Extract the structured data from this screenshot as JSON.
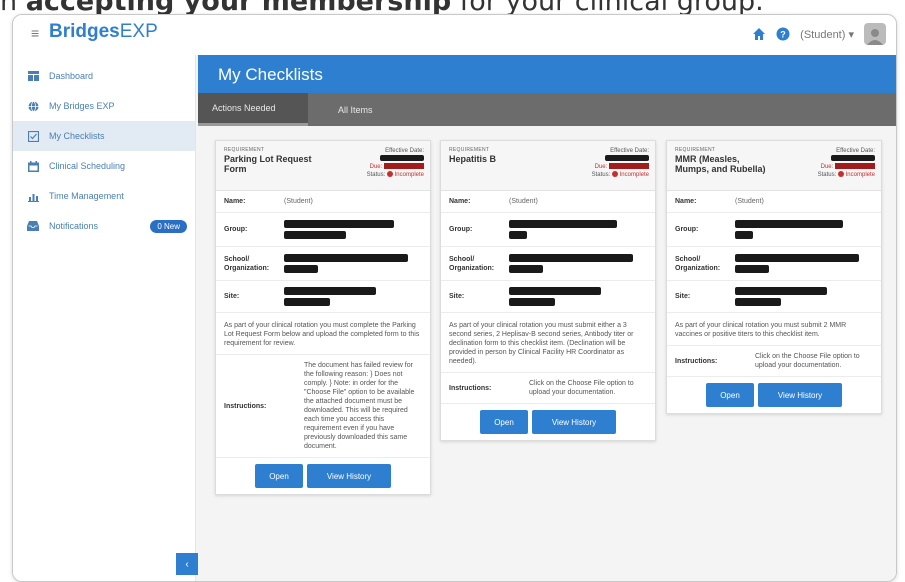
{
  "caption": {
    "prefix": "n ",
    "bold": "accepting your membership",
    "suffix": " for your clinical group."
  },
  "app": {
    "logo": "Bridges",
    "logo_suffix": "EXP",
    "user": "(Student)",
    "user_caret": "▾",
    "menu_icon": "hamburger-icon"
  },
  "sidebar": {
    "items": [
      {
        "label": "Dashboard",
        "icon": "dashboard-icon"
      },
      {
        "label": "My Bridges EXP",
        "icon": "globe-icon"
      },
      {
        "label": "My Checklists",
        "icon": "checklist-icon",
        "active": true
      },
      {
        "label": "Clinical Scheduling",
        "icon": "calendar-icon"
      },
      {
        "label": "Time Management",
        "icon": "chart-icon"
      },
      {
        "label": "Notifications",
        "icon": "inbox-icon",
        "badge": "0 New"
      }
    ],
    "collapse_label": "‹"
  },
  "page": {
    "title": "My Checklists"
  },
  "tabs": [
    {
      "label": "Actions Needed",
      "active": true
    },
    {
      "label": "All Items"
    }
  ],
  "card_labels": {
    "type": "REQUIREMENT",
    "effective_date": "Effective Date:",
    "due": "Due:",
    "status": "Status:",
    "status_value": "Incomplete",
    "name": "Name:",
    "group": "Group:",
    "school": "School/ Organization:",
    "site": "Site:",
    "instructions": "Instructions:",
    "open": "Open",
    "history": "View History"
  },
  "cards": [
    {
      "title": "Parking Lot Request Form",
      "name_value": "(Student)",
      "description": "As part of your clinical rotation you must complete the Parking Lot Request Form below and upload the completed form to this requirement for review.",
      "instructions": "The document has failed review for the following reason: } Does not comply. } Note: in order for the \"Choose File\" option to be available the attached document must be downloaded. This will be required each time you access this requirement even if you have previously downloaded this same document."
    },
    {
      "title": "Hepatitis B",
      "name_value": "(Student)",
      "description": "As part of your clinical rotation you must submit either a 3 second series, 2 Heplisav-B second series, Antibody titer or declination form to this checklist item. (Declination will be provided in person by Clinical Facility HR Coordinator as needed).",
      "instructions": "Click on the Choose File option to upload your documentation."
    },
    {
      "title": "MMR (Measles, Mumps, and Rubella)",
      "name_value": "(Student)",
      "description": "As part of your clinical rotation you must submit 2 MMR vaccines or positive titers to this checklist item.",
      "instructions": "Click on the Choose File option to upload your documentation."
    }
  ],
  "colors": {
    "primary": "#2f7fd0",
    "tabbar": "#6c6c6c",
    "status": "#c43030"
  }
}
